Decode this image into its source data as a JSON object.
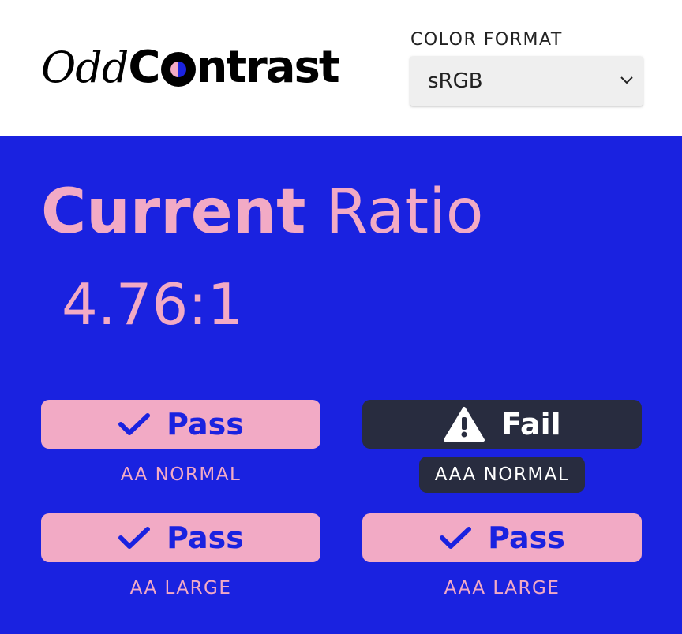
{
  "app": {
    "logo_odd": "Odd",
    "logo_c": "C",
    "logo_rest": "ntrast"
  },
  "format": {
    "label": "COLOR FORMAT",
    "selected": "sRGB"
  },
  "heading": {
    "bold": "Current",
    "light": "Ratio"
  },
  "ratio": "4.76:1",
  "results": [
    {
      "status": "Pass",
      "label": "AA NORMAL",
      "icon": "check-icon"
    },
    {
      "status": "Fail",
      "label": "AAA NORMAL",
      "icon": "warning-icon"
    },
    {
      "status": "Pass",
      "label": "AA LARGE",
      "icon": "check-icon"
    },
    {
      "status": "Pass",
      "label": "AAA LARGE",
      "icon": "check-icon"
    }
  ],
  "colors": {
    "background": "#1a22e0",
    "accent": "#f2aac5",
    "fail": "#282c3f"
  }
}
